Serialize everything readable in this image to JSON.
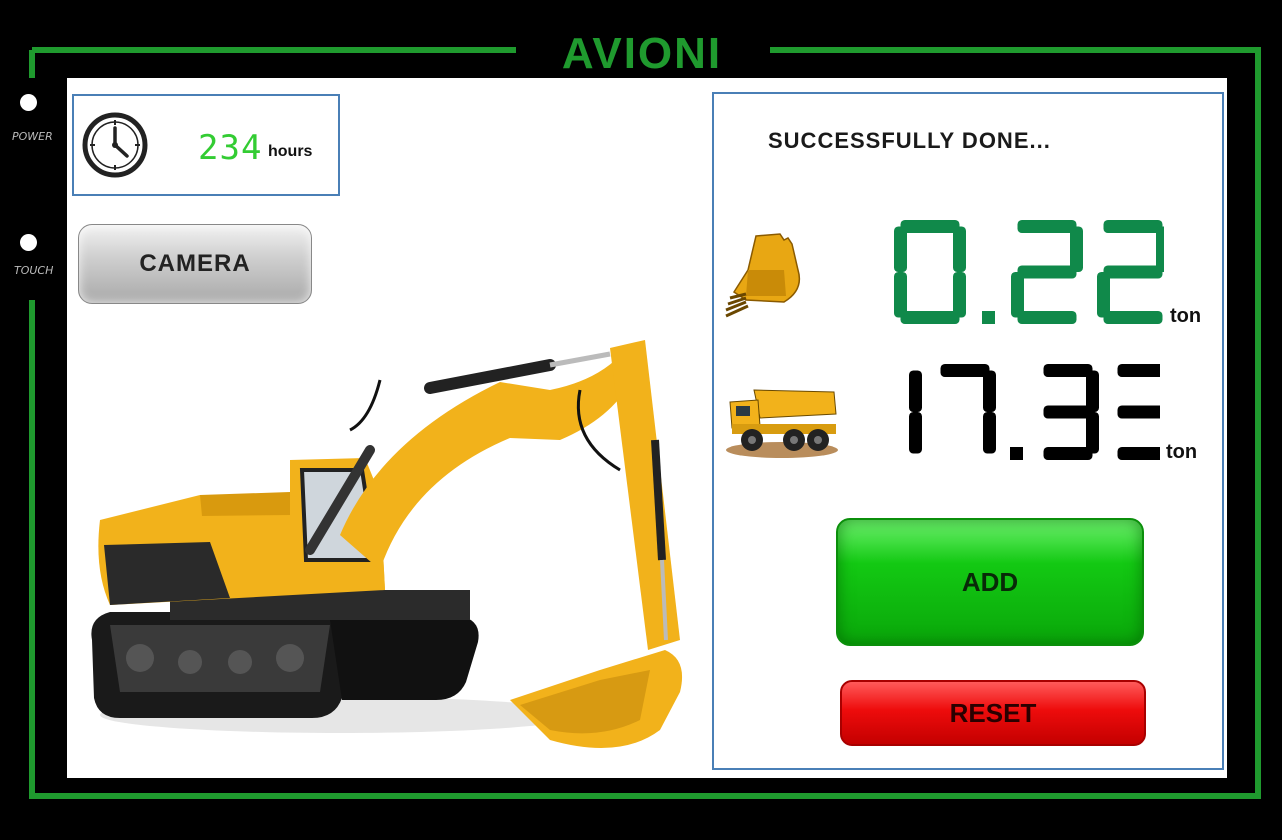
{
  "brand": {
    "name": "AVIONI"
  },
  "side": {
    "power_label": "POWER",
    "touch_label": "TOUCH"
  },
  "hours": {
    "value": "234",
    "unit": "hours",
    "icon": "clock-icon"
  },
  "camera": {
    "label": "CAMERA"
  },
  "status": {
    "text": "SUCCESSFULLY DONE..."
  },
  "bucket": {
    "value": "0.22",
    "unit": "ton",
    "icon": "bucket-icon"
  },
  "truck": {
    "value": "17.33",
    "unit": "ton",
    "icon": "dump-truck-icon"
  },
  "buttons": {
    "add": "ADD",
    "reset": "RESET"
  },
  "colors": {
    "frame_green": "#1f9a2e",
    "bucket_digits": "#10894a",
    "truck_digits": "#000000",
    "hours_digits": "#33cc33",
    "add": "#13c913",
    "reset": "#ee0c0c",
    "panel_border": "#4a7fb6"
  }
}
